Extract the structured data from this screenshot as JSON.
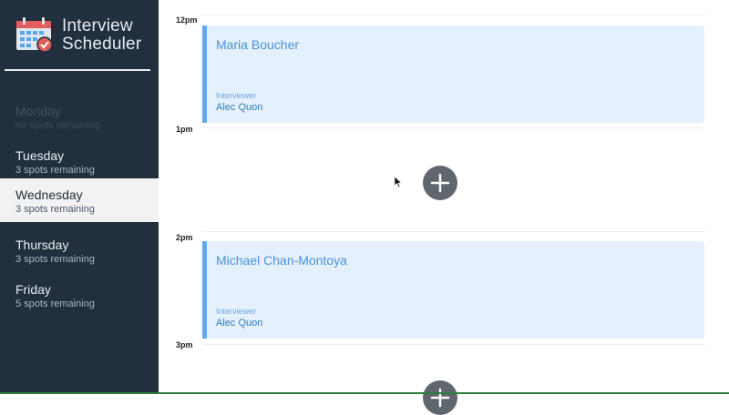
{
  "app": {
    "title_line1": "Interview",
    "title_line2": "Scheduler",
    "logo_icon": "calendar-check-icon"
  },
  "days": [
    {
      "name": "Monday",
      "spots": "no spots remaining",
      "state": "full"
    },
    {
      "name": "Tuesday",
      "spots": "3 spots remaining",
      "state": "normal"
    },
    {
      "name": "Wednesday",
      "spots": "3 spots remaining",
      "state": "selected"
    },
    {
      "name": "Thursday",
      "spots": "3 spots remaining",
      "state": "normal"
    },
    {
      "name": "Friday",
      "spots": "5 spots remaining",
      "state": "normal"
    }
  ],
  "times": [
    "12pm",
    "1pm",
    "2pm",
    "3pm"
  ],
  "appointments": [
    {
      "student": "Maria Boucher",
      "interviewer_label": "Interviewer",
      "interviewer": "Alec Quon"
    },
    {
      "student": "Michael Chan-Montoya",
      "interviewer_label": "Interviewer",
      "interviewer": "Alec Quon"
    }
  ],
  "colors": {
    "sidebar": "#222f3e",
    "appointment_bg": "#e4f0fb",
    "appointment_accent": "#5ea9f4",
    "add_button": "#5f666d"
  }
}
